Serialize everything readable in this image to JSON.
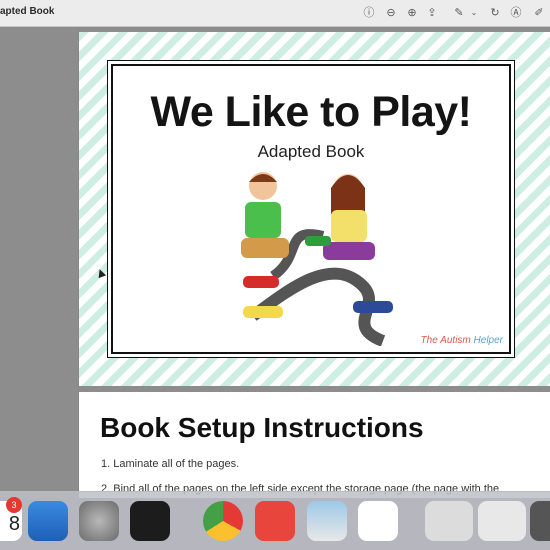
{
  "window": {
    "title": "apted Book"
  },
  "toolbar": {
    "icons": [
      "info-icon",
      "zoom-out-icon",
      "zoom-in-icon",
      "share-icon",
      "markup-pen-icon",
      "chevron-down-icon",
      "rotate-icon",
      "markup-circle-icon",
      "edit-icon"
    ]
  },
  "cover": {
    "title": "We Like to Play!",
    "subtitle": "Adapted Book",
    "logo_part1": "The Autism",
    "logo_part2": "Helper"
  },
  "instructions": {
    "heading": "Book Setup Instructions",
    "items": [
      "1.   Laminate all of the pages.",
      "2. Bind all of the pages on the left side except the storage page (the page with the"
    ]
  },
  "dock": {
    "calendar_badge": "3",
    "calendar_day": "8"
  },
  "colors": {
    "stripe": "#cfeee3",
    "badge": "#e5392f"
  }
}
